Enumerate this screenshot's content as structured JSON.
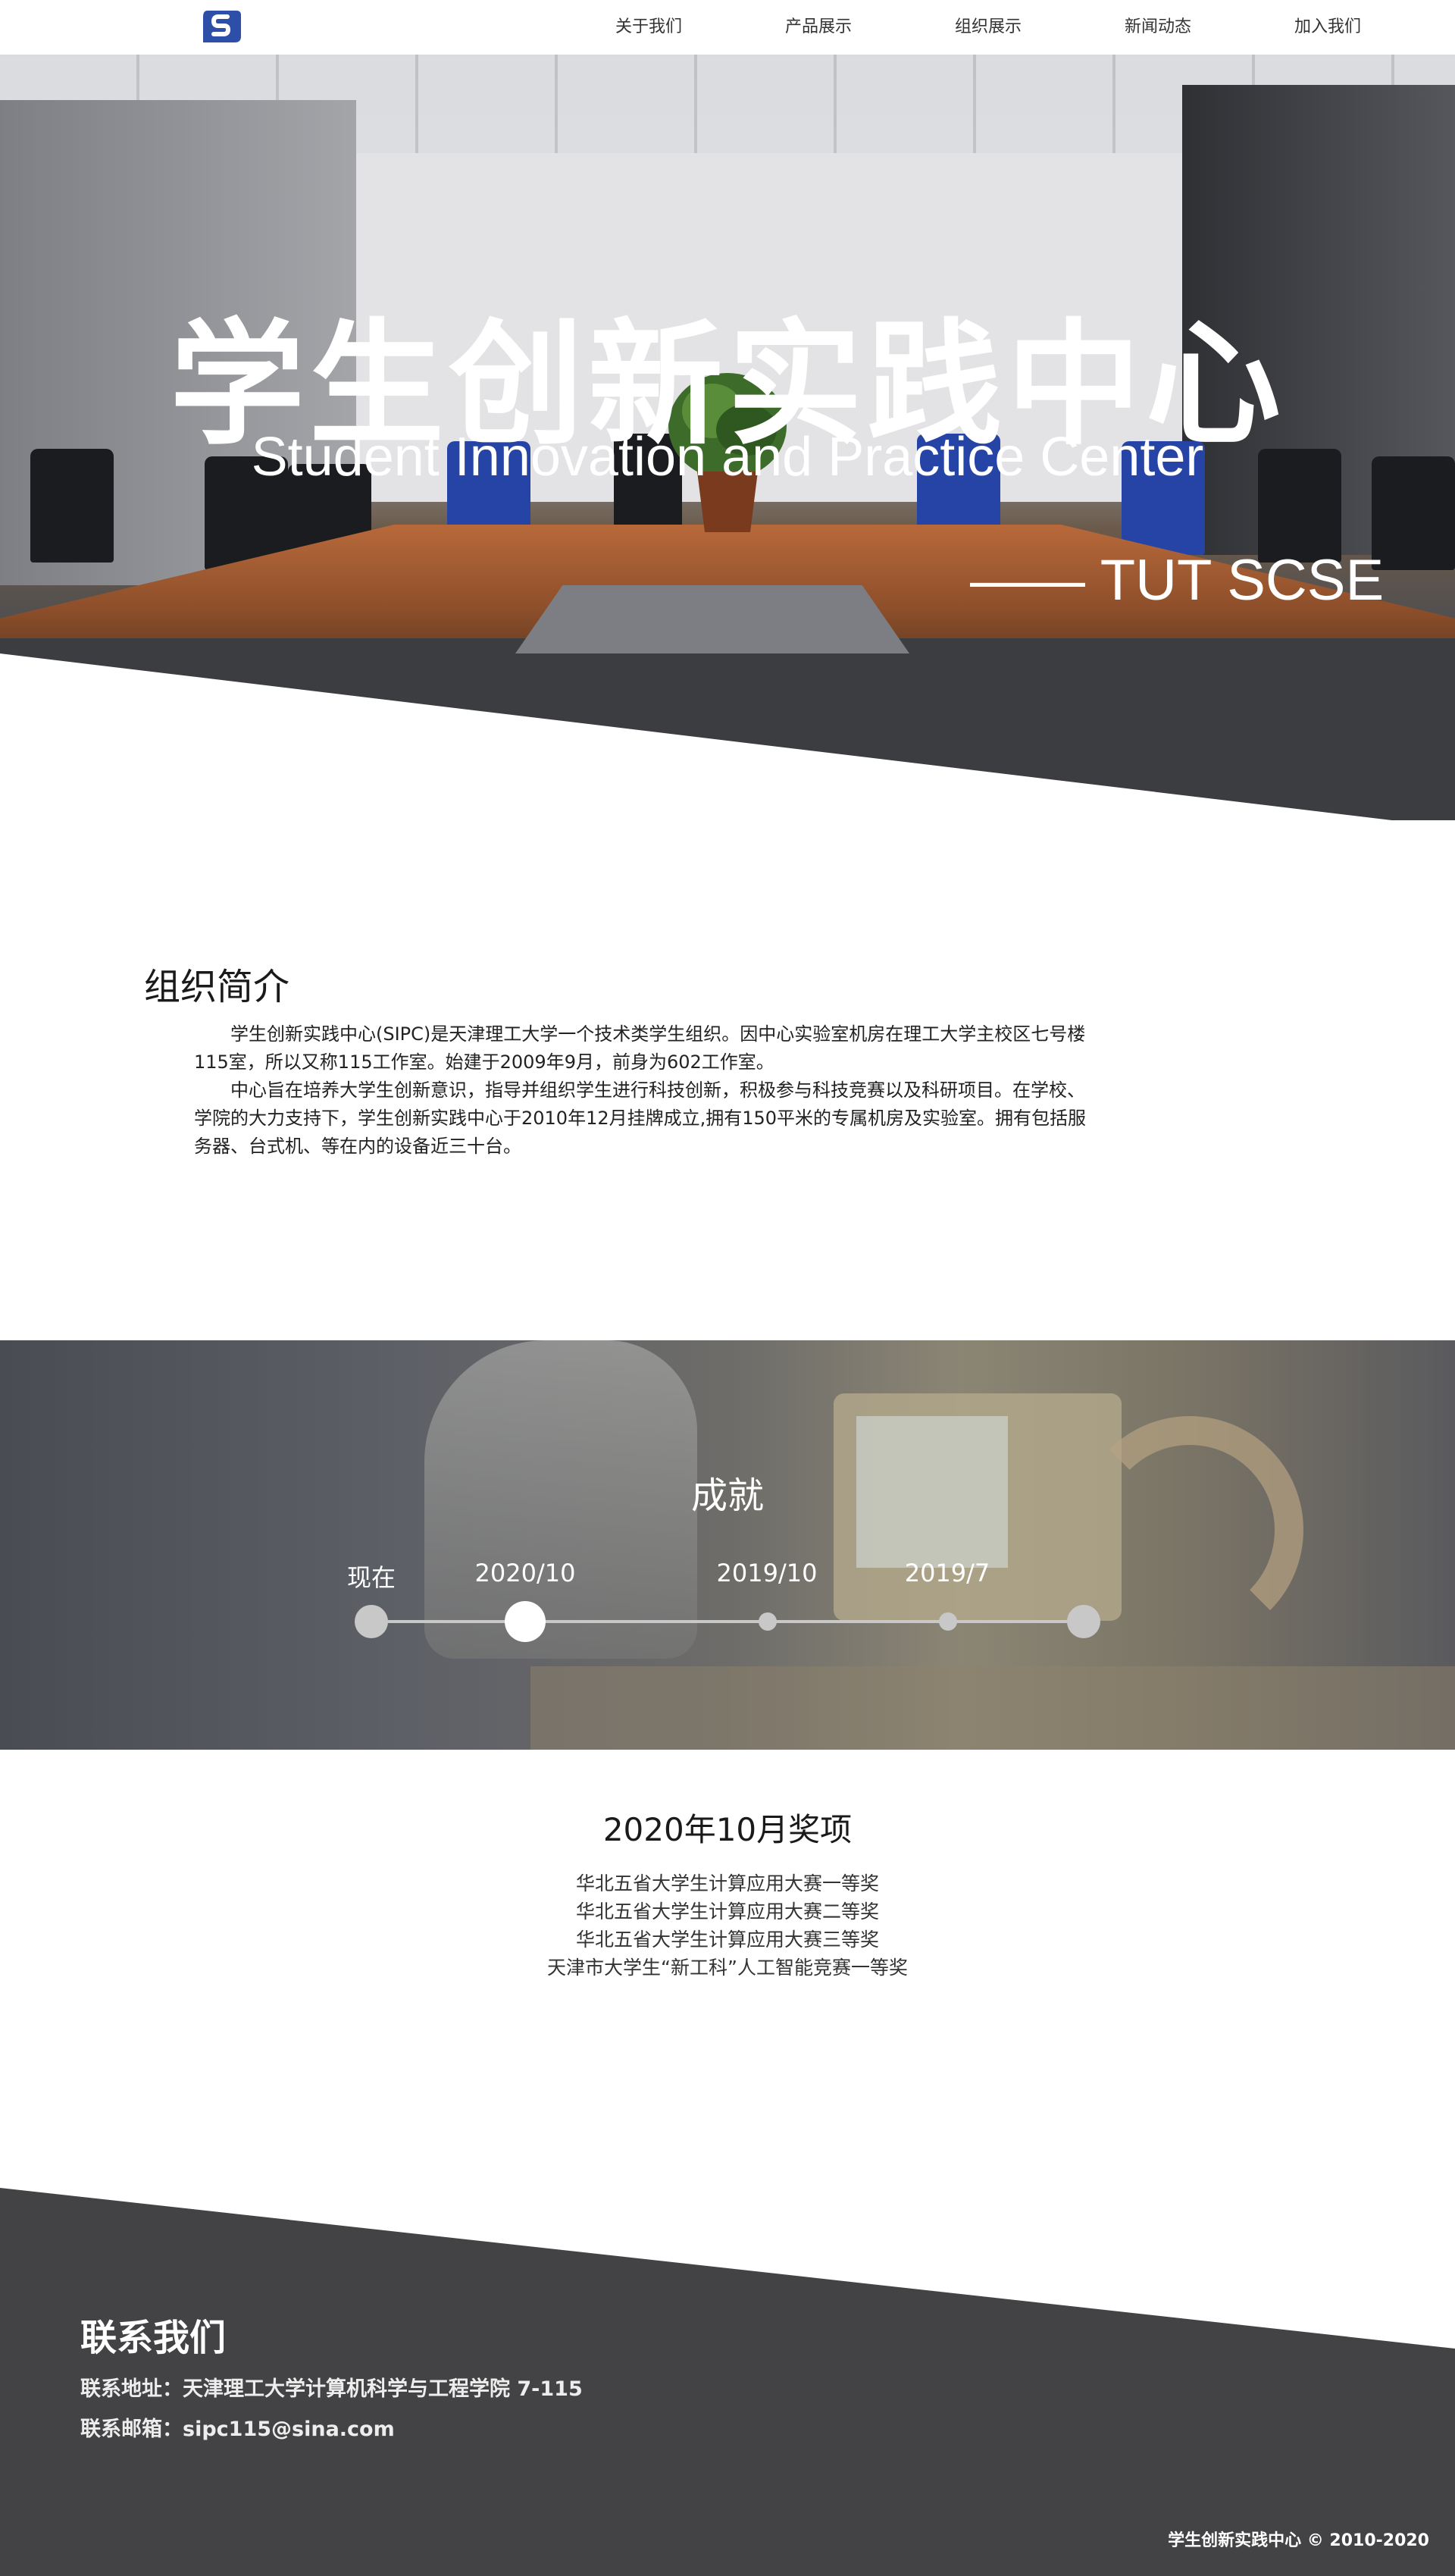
{
  "nav": {
    "items": [
      "关于我们",
      "产品展示",
      "组织展示",
      "新闻动态",
      "加入我们"
    ],
    "logo_color": "#2e4fa8"
  },
  "hero": {
    "title": "学生创新实践中心",
    "subtitle": "Student Innovation and Practice Center",
    "tagline": "—— TUT SCSE"
  },
  "intro": {
    "title": "组织简介",
    "paragraphs": [
      "学生创新实践中心(SIPC)是天津理工大学一个技术类学生组织。因中心实验室机房在理工大学主校区七号楼115室，所以又称115工作室。始建于2009年9月，前身为602工作室。",
      "中心旨在培养大学生创新意识，指导并组织学生进行科技创新，积极参与科技竞赛以及科研项目。在学校、学院的大力支持下，学生创新实践中心于2010年12月挂牌成立,拥有150平米的专属机房及实验室。拥有包括服务器、台式机、等在内的设备近三十台。"
    ]
  },
  "achievements": {
    "title": "成就",
    "timeline": [
      "现在",
      "2020/10",
      "2019/10",
      "2019/7"
    ],
    "active_index": 1
  },
  "awards": {
    "title": "2020年10月奖项",
    "items": [
      "华北五省大学生计算应用大赛一等奖",
      "华北五省大学生计算应用大赛二等奖",
      "华北五省大学生计算应用大赛三等奖",
      "天津市大学生“新工科”人工智能竞赛一等奖"
    ]
  },
  "footer": {
    "title": "联系我们",
    "address": "联系地址：天津理工大学计算机科学与工程学院 7-115",
    "email": "联系邮箱：sipc115@sina.com",
    "copyright": "学生创新实践中心 © 2010-2020"
  }
}
